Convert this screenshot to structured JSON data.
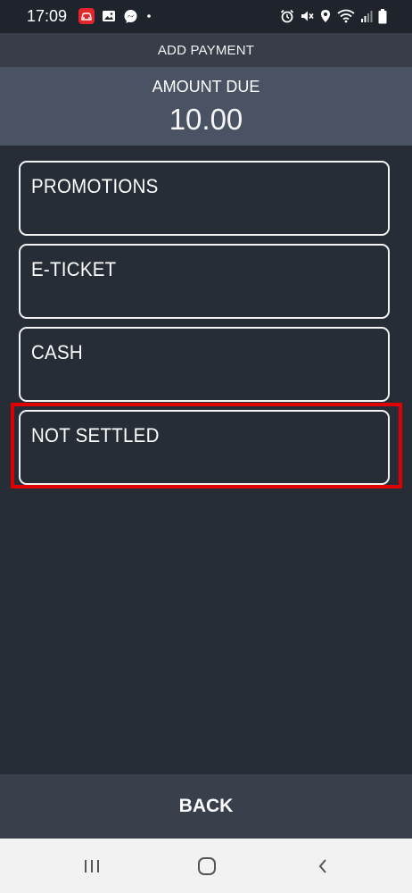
{
  "status_bar": {
    "time": "17:09",
    "left_icons": [
      "car-app-icon",
      "gallery-icon",
      "messenger-icon",
      "dot-icon"
    ],
    "right_icons": [
      "alarm-icon",
      "mute-icon",
      "location-icon",
      "wifi-icon",
      "signal-icon",
      "battery-icon"
    ]
  },
  "header": {
    "title": "ADD PAYMENT"
  },
  "amount": {
    "label": "AMOUNT DUE",
    "value": "10.00"
  },
  "options": [
    {
      "label": "PROMOTIONS"
    },
    {
      "label": "E-TICKET"
    },
    {
      "label": "CASH"
    },
    {
      "label": "NOT SETTLED",
      "highlighted": true
    }
  ],
  "footer": {
    "back_label": "BACK"
  },
  "nav": {
    "icons": [
      "recent-apps-icon",
      "home-icon",
      "back-nav-icon"
    ]
  },
  "colors": {
    "background": "#272d36",
    "amount_panel": "#4a5364",
    "highlight": "#e10000"
  }
}
